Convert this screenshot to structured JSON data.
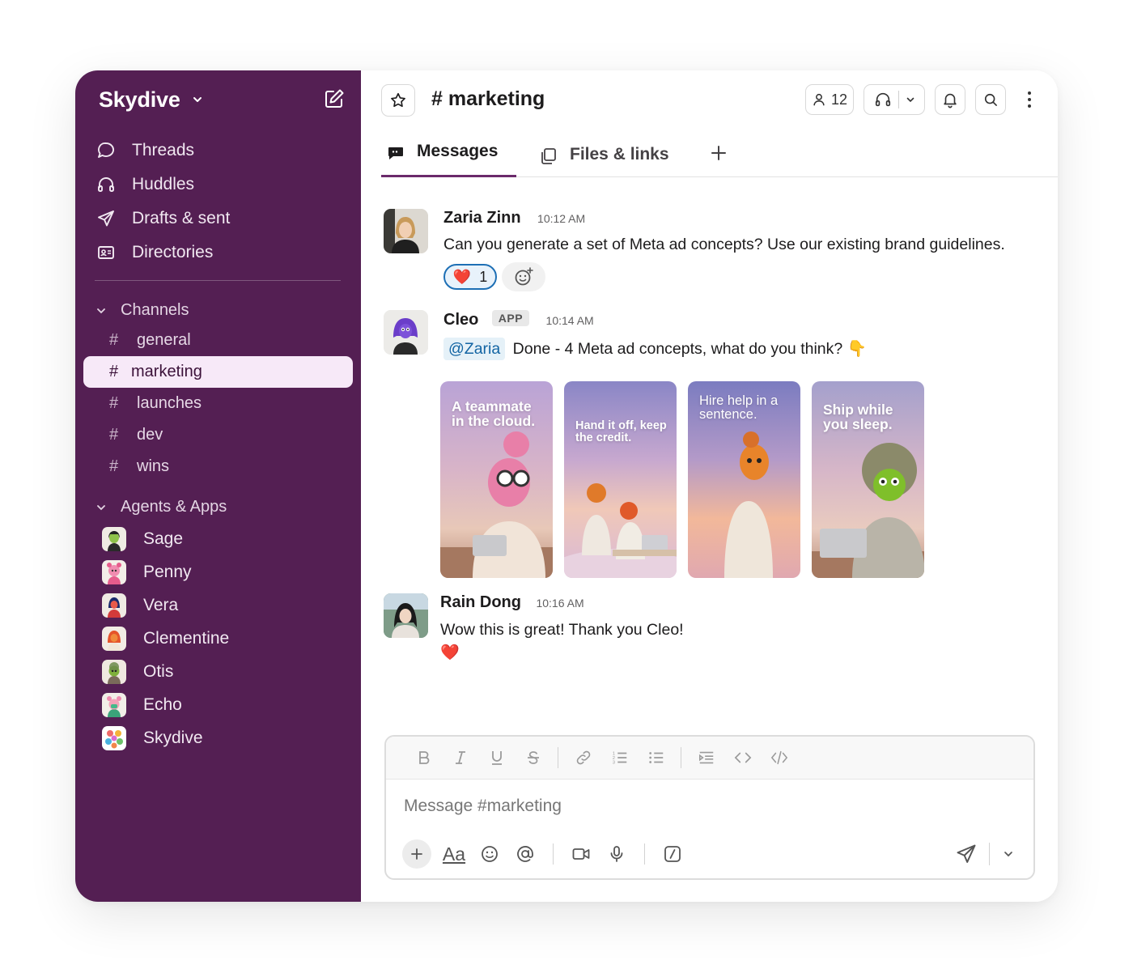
{
  "workspace": {
    "name": "Skydive"
  },
  "nav": [
    {
      "label": "Threads",
      "icon": "threads-icon"
    },
    {
      "label": "Huddles",
      "icon": "headphones-icon"
    },
    {
      "label": "Drafts & sent",
      "icon": "send-icon"
    },
    {
      "label": "Directories",
      "icon": "id-card-icon"
    }
  ],
  "sections": {
    "channels_label": "Channels",
    "apps_label": "Agents & Apps"
  },
  "channels": [
    {
      "name": "general",
      "active": false
    },
    {
      "name": "marketing",
      "active": true
    },
    {
      "name": "launches",
      "active": false
    },
    {
      "name": "dev",
      "active": false
    },
    {
      "name": "wins",
      "active": false
    }
  ],
  "apps": [
    {
      "name": "Sage"
    },
    {
      "name": "Penny"
    },
    {
      "name": "Vera"
    },
    {
      "name": "Clementine"
    },
    {
      "name": "Otis"
    },
    {
      "name": "Echo"
    },
    {
      "name": "Skydive"
    }
  ],
  "header": {
    "channel": "# marketing",
    "member_count": "12"
  },
  "tabs": {
    "messages": "Messages",
    "files": "Files & links",
    "add": "+"
  },
  "messages": [
    {
      "author": "Zaria Zinn",
      "time": "10:12 AM",
      "text": "Can you generate a set of Meta ad concepts? Use our existing brand guidelines.",
      "reaction": {
        "emoji": "❤️",
        "count": "1"
      }
    },
    {
      "author": "Cleo",
      "badge": "APP",
      "time": "10:14 AM",
      "mention": "@Zaria",
      "text": "Done - 4 Meta ad concepts, what do you think? 👇",
      "cards": [
        {
          "caption": "A teammate in the cloud."
        },
        {
          "caption": "Hand it off, keep the credit."
        },
        {
          "caption": "Hire help in a sentence."
        },
        {
          "caption": "Ship while you sleep."
        }
      ]
    },
    {
      "author": "Rain Dong",
      "time": "10:16 AM",
      "text": "Wow this is great! Thank you Cleo!",
      "emoji": "❤️"
    }
  ],
  "composer": {
    "placeholder": "Message #marketing",
    "format_label": "Aa"
  },
  "colors": {
    "sidebar": "#541f53",
    "active_channel": "#f7e9f8",
    "reaction_border": "#1d6fb5",
    "mention": "#1264a3"
  }
}
